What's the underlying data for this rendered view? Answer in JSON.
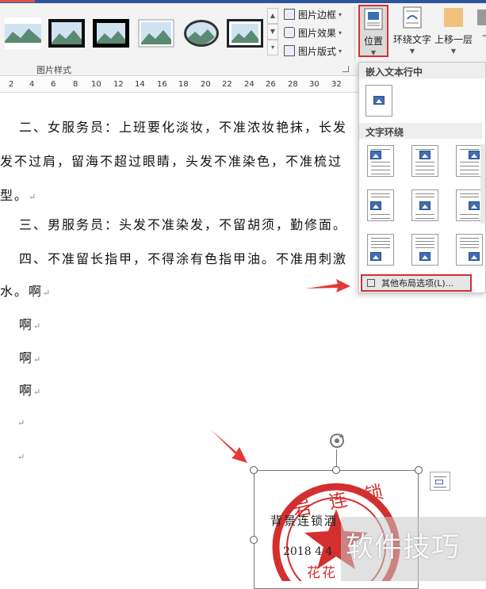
{
  "ribbon": {
    "group_label": "图片样式",
    "commands": {
      "border": "图片边框",
      "effects": "图片效果",
      "layout": "图片版式"
    },
    "position_button": "位置",
    "wrap_button": "环绕文字",
    "bring_forward_button": "上移一层",
    "next_button": "下"
  },
  "ruler_ticks": [
    "2",
    "4",
    "6",
    "8",
    "10",
    "12",
    "14",
    "16",
    "18",
    "20",
    "22",
    "24",
    "26",
    "28",
    "30",
    "32"
  ],
  "document": {
    "lines": [
      "二、女服务员：上班要化淡妆，不准浓妆艳抹，长发",
      "发不过肩，留海不超过眼睛，头发不准染色，不准梳过",
      "型。",
      "三、男服务员：头发不准染发，不留胡须，勤修面。",
      "四、不准留长指甲，不得涂有色指甲油。不准用刺激",
      "水。啊",
      "啊",
      "啊",
      "啊"
    ],
    "paragraph_mark": "↵"
  },
  "dropdown": {
    "inline_header": "嵌入文本行中",
    "wrap_header": "文字环绕",
    "more_options": "其他布局选项(L)..."
  },
  "seal": {
    "ring_text": "岩 连 锁",
    "name_text": "背景连锁酒",
    "date_text": "2018 4 4",
    "bottom_text": "花花"
  },
  "watermark": "软件技巧",
  "colors": {
    "accent_red": "#d32f2f",
    "ribbon_bg": "#f3f3f3",
    "brand_blue": "#2b579a"
  }
}
